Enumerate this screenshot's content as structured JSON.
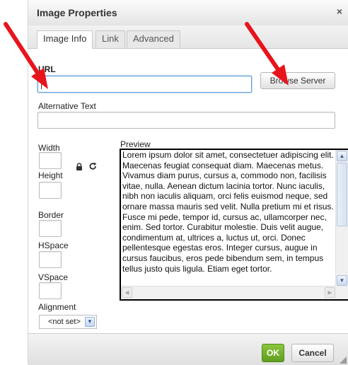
{
  "dialog": {
    "title": "Image Properties",
    "close_glyph": "×"
  },
  "tabs": [
    {
      "label": "Image Info",
      "active": true
    },
    {
      "label": "Link",
      "active": false
    },
    {
      "label": "Advanced",
      "active": false
    }
  ],
  "url": {
    "label": "URL",
    "value": ""
  },
  "browse_button": "Browse Server",
  "alt_text": {
    "label": "Alternative Text",
    "value": ""
  },
  "width": {
    "label": "Width",
    "value": ""
  },
  "height": {
    "label": "Height",
    "value": ""
  },
  "border": {
    "label": "Border",
    "value": ""
  },
  "hspace": {
    "label": "HSpace",
    "value": ""
  },
  "vspace": {
    "label": "VSpace",
    "value": ""
  },
  "alignment": {
    "label": "Alignment",
    "selected": "<not set>"
  },
  "icons": {
    "lock": "lock-icon",
    "reset": "reset-size-icon",
    "lock_glyph": "🔒",
    "reset_glyph": "↻"
  },
  "preview": {
    "label": "Preview",
    "text": "Lorem ipsum dolor sit amet, consectetuer adipiscing elit. Maecenas feugiat consequat diam. Maecenas metus. Vivamus diam purus, cursus a, commodo non, facilisis vitae, nulla. Aenean dictum lacinia tortor. Nunc iaculis, nibh non iaculis aliquam, orci felis euismod neque, sed ornare massa mauris sed velit. Nulla pretium mi et risus. Fusce mi pede, tempor id, cursus ac, ullamcorper nec, enim. Sed tortor. Curabitur molestie. Duis velit augue, condimentum at, ultrices a, luctus ut, orci. Donec pellentesque egestas eros. Integer cursus, augue in cursus faucibus, eros pede bibendum sem, in tempus tellus justo quis ligula. Etiam eget tortor."
  },
  "footer": {
    "ok": "OK",
    "cancel": "Cancel"
  },
  "colors": {
    "annotation_arrow": "#e8141c",
    "ok_green": "#6aac2b",
    "focus_blue": "#5b9bd5"
  }
}
